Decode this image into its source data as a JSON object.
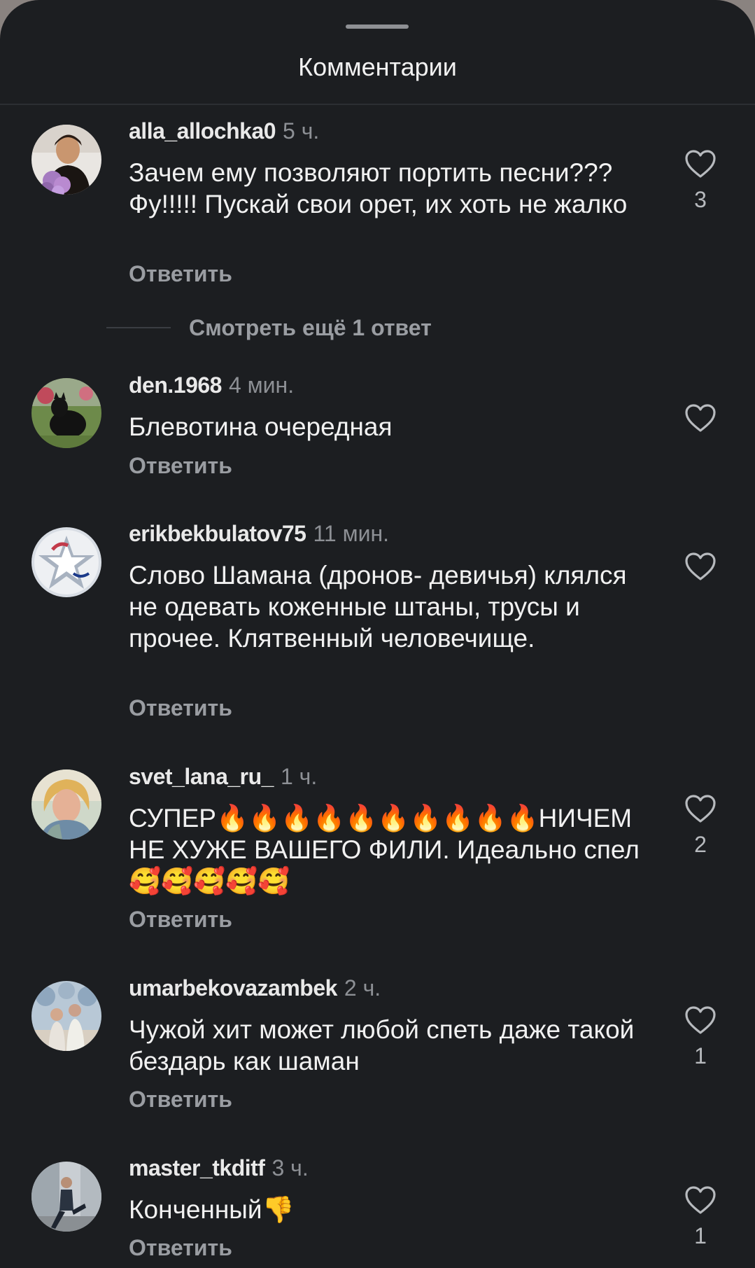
{
  "header": {
    "title": "Комментарии"
  },
  "actions": {
    "reply_label": "Ответить",
    "more_replies_label": "Смотреть ещё 1 ответ"
  },
  "comments": [
    {
      "username": "alla_allochka0",
      "time": "5 ч.",
      "text": "Зачем ему позволяют портить песни??? Фу!!!!! Пускай свои орет, их хоть не жалко",
      "likes": "3"
    },
    {
      "username": "den.1968",
      "time": "4 мин.",
      "text": "Блевотина очередная",
      "likes": ""
    },
    {
      "username": "erikbekbulatov75",
      "time": "11 мин.",
      "text": "Слово Шамана (дронов- девичья) клялся не одевать коженные штаны, трусы и прочее. Клятвенный человечище.",
      "likes": ""
    },
    {
      "username": "svet_lana_ru_",
      "time": "1 ч.",
      "text": "СУПЕР🔥🔥🔥🔥🔥🔥🔥🔥🔥🔥НИЧЕМ НЕ ХУЖЕ ВАШЕГО ФИЛИ. Идеально спел🥰🥰🥰🥰🥰",
      "likes": "2"
    },
    {
      "username": "umarbekovazambek",
      "time": "2 ч.",
      "text": "Чужой хит может любой спеть даже такой бездарь  как шаман",
      "likes": "1"
    },
    {
      "username": "master_tkditf",
      "time": "3 ч.",
      "text": "Конченный👎",
      "likes": "1"
    }
  ],
  "icons": {
    "like": "heart-outline-icon"
  },
  "colors": {
    "background": "#1c1e21",
    "text": "#f1f1f1",
    "muted": "#9a9da2"
  }
}
